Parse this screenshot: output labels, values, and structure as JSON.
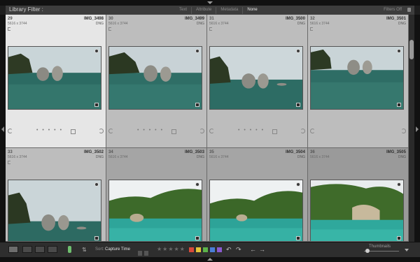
{
  "filter_bar": {
    "title": "Library Filter :",
    "tabs": [
      "Text",
      "Attribute",
      "Metadata",
      "None"
    ],
    "active_tab": "None",
    "preset_label": "Filters Off"
  },
  "cells": [
    {
      "index": "29",
      "dims": "5616 x 3744",
      "name": "IMG_3498",
      "type": "DNG"
    },
    {
      "index": "30",
      "dims": "5616 x 3744",
      "name": "IMG_3499",
      "type": "DNG"
    },
    {
      "index": "31",
      "dims": "5616 x 3744",
      "name": "IMG_3500",
      "type": "DNG"
    },
    {
      "index": "32",
      "dims": "5616 x 3744",
      "name": "IMG_3501",
      "type": "DNG"
    },
    {
      "index": "33",
      "dims": "5616 x 3744",
      "name": "IMG_3502",
      "type": "DNG"
    },
    {
      "index": "34",
      "dims": "5616 x 3744",
      "name": "IMG_3503",
      "type": "DNG"
    },
    {
      "index": "35",
      "dims": "5616 x 3744",
      "name": "IMG_3504",
      "type": "DNG"
    },
    {
      "index": "36",
      "dims": "5616 x 3744",
      "name": "IMG_3505",
      "type": "DNG"
    }
  ],
  "toolbar": {
    "sort_label": "Sort:",
    "sort_value": "Capture Time",
    "thumbnails_label": "Thumbnails",
    "color_labels": [
      "#d84a3a",
      "#e4c43a",
      "#5cb34a",
      "#4a7ed8",
      "#8a5ad0"
    ],
    "stars": "★★★★★",
    "icons": {
      "grid": "grid-view-icon",
      "loupe": "loupe-view-icon",
      "compare": "compare-view-icon",
      "survey": "survey-view-icon",
      "spray": "painter-spray-icon",
      "sort": "sort-direction-icon",
      "rotate_left": "rotate-left-icon",
      "rotate_right": "rotate-right-icon",
      "prev": "previous-arrow-icon",
      "next": "next-arrow-icon"
    }
  }
}
